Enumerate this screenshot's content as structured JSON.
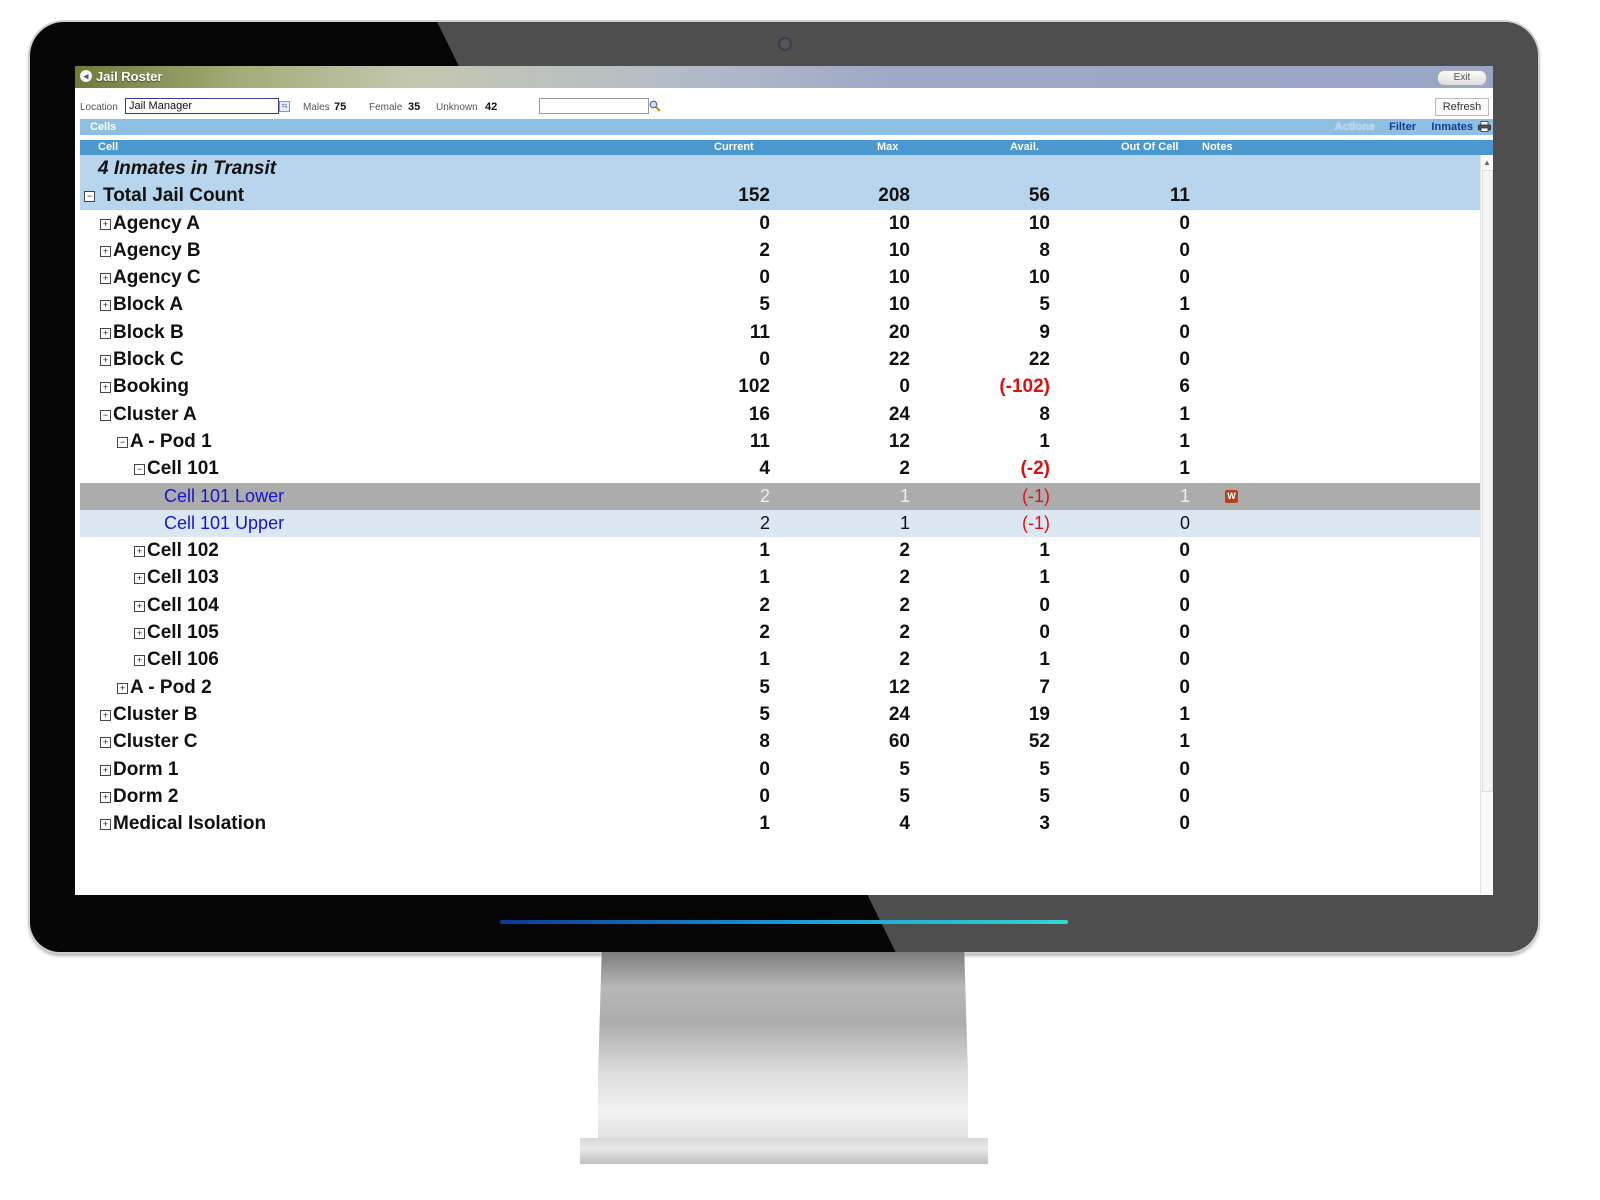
{
  "window": {
    "title": "Jail Roster",
    "exit_label": "Exit"
  },
  "toolbar": {
    "location_label": "Location",
    "location_value": "Jail Manager",
    "males_label": "Males",
    "males_value": "75",
    "female_label": "Female",
    "female_value": "35",
    "unknown_label": "Unknown",
    "unknown_value": "42",
    "search_value": "",
    "refresh_label": "Refresh"
  },
  "cells_bar": {
    "title": "Cells",
    "actions_label": "Actions",
    "filter_label": "Filter",
    "inmates_label": "Inmates"
  },
  "columns": {
    "cell": "Cell",
    "current": "Current",
    "max": "Max",
    "avail": "Avail.",
    "out_of_cell": "Out Of Cell",
    "notes": "Notes"
  },
  "transit_text": "4 Inmates in Transit",
  "rows": [
    {
      "label": "Total Jail Count",
      "level": 0,
      "toggle": "minus",
      "current": "152",
      "max": "208",
      "avail": "56",
      "out": "11",
      "style": "hilite"
    },
    {
      "label": "Agency A",
      "level": 1,
      "toggle": "plus",
      "current": "0",
      "max": "10",
      "avail": "10",
      "out": "0"
    },
    {
      "label": "Agency B",
      "level": 1,
      "toggle": "plus",
      "current": "2",
      "max": "10",
      "avail": "8",
      "out": "0"
    },
    {
      "label": "Agency C",
      "level": 1,
      "toggle": "plus",
      "current": "0",
      "max": "10",
      "avail": "10",
      "out": "0"
    },
    {
      "label": "Block A",
      "level": 1,
      "toggle": "plus",
      "current": "5",
      "max": "10",
      "avail": "5",
      "out": "1"
    },
    {
      "label": "Block B",
      "level": 1,
      "toggle": "plus",
      "current": "11",
      "max": "20",
      "avail": "9",
      "out": "0"
    },
    {
      "label": "Block C",
      "level": 1,
      "toggle": "plus",
      "current": "0",
      "max": "22",
      "avail": "22",
      "out": "0"
    },
    {
      "label": "Booking",
      "level": 1,
      "toggle": "plus",
      "current": "102",
      "max": "0",
      "avail": "(-102)",
      "out": "6",
      "avail_negative": true
    },
    {
      "label": "Cluster A",
      "level": 1,
      "toggle": "minus",
      "current": "16",
      "max": "24",
      "avail": "8",
      "out": "1"
    },
    {
      "label": "A - Pod 1",
      "level": 2,
      "toggle": "minus",
      "current": "11",
      "max": "12",
      "avail": "1",
      "out": "1"
    },
    {
      "label": "Cell 101",
      "level": 3,
      "toggle": "minus",
      "current": "4",
      "max": "2",
      "avail": "(-2)",
      "out": "1",
      "avail_negative": true
    },
    {
      "label": "Cell 101 Lower",
      "level": 4,
      "toggle": "",
      "current": "2",
      "max": "1",
      "avail": "(-1)",
      "out": "1",
      "avail_negative": true,
      "style": "selected",
      "leaf": true,
      "note": "W"
    },
    {
      "label": "Cell 101 Upper",
      "level": 4,
      "toggle": "",
      "current": "2",
      "max": "1",
      "avail": "(-1)",
      "out": "0",
      "avail_negative": true,
      "style": "alt",
      "leaf": true
    },
    {
      "label": "Cell 102",
      "level": 3,
      "toggle": "plus",
      "current": "1",
      "max": "2",
      "avail": "1",
      "out": "0"
    },
    {
      "label": "Cell 103",
      "level": 3,
      "toggle": "plus",
      "current": "1",
      "max": "2",
      "avail": "1",
      "out": "0"
    },
    {
      "label": "Cell 104",
      "level": 3,
      "toggle": "plus",
      "current": "2",
      "max": "2",
      "avail": "0",
      "out": "0"
    },
    {
      "label": "Cell 105",
      "level": 3,
      "toggle": "plus",
      "current": "2",
      "max": "2",
      "avail": "0",
      "out": "0"
    },
    {
      "label": "Cell 106",
      "level": 3,
      "toggle": "plus",
      "current": "1",
      "max": "2",
      "avail": "1",
      "out": "0"
    },
    {
      "label": "A - Pod 2",
      "level": 2,
      "toggle": "plus",
      "current": "5",
      "max": "12",
      "avail": "7",
      "out": "0"
    },
    {
      "label": "Cluster B",
      "level": 1,
      "toggle": "plus",
      "current": "5",
      "max": "24",
      "avail": "19",
      "out": "1"
    },
    {
      "label": "Cluster C",
      "level": 1,
      "toggle": "plus",
      "current": "8",
      "max": "60",
      "avail": "52",
      "out": "1"
    },
    {
      "label": "Dorm 1",
      "level": 1,
      "toggle": "plus",
      "current": "0",
      "max": "5",
      "avail": "5",
      "out": "0"
    },
    {
      "label": "Dorm 2",
      "level": 1,
      "toggle": "plus",
      "current": "0",
      "max": "5",
      "avail": "5",
      "out": "0"
    },
    {
      "label": "Medical Isolation",
      "level": 1,
      "toggle": "plus",
      "current": "1",
      "max": "4",
      "avail": "3",
      "out": "0"
    }
  ],
  "icons": {
    "toggle_plus": "⊞",
    "toggle_minus": "⊟",
    "app": "app-logo-icon",
    "search": "magnifier-icon",
    "printer": "printer-icon",
    "note": "word-document-icon"
  },
  "colors": {
    "header_blue": "#4b97cf",
    "cells_bar": "#8dbfe3",
    "highlight_row": "#b7d6ed",
    "selected_row": "#acacac",
    "alt_row": "#dbe8f4",
    "negative": "#e01010",
    "leaf_link": "#1515cc"
  }
}
